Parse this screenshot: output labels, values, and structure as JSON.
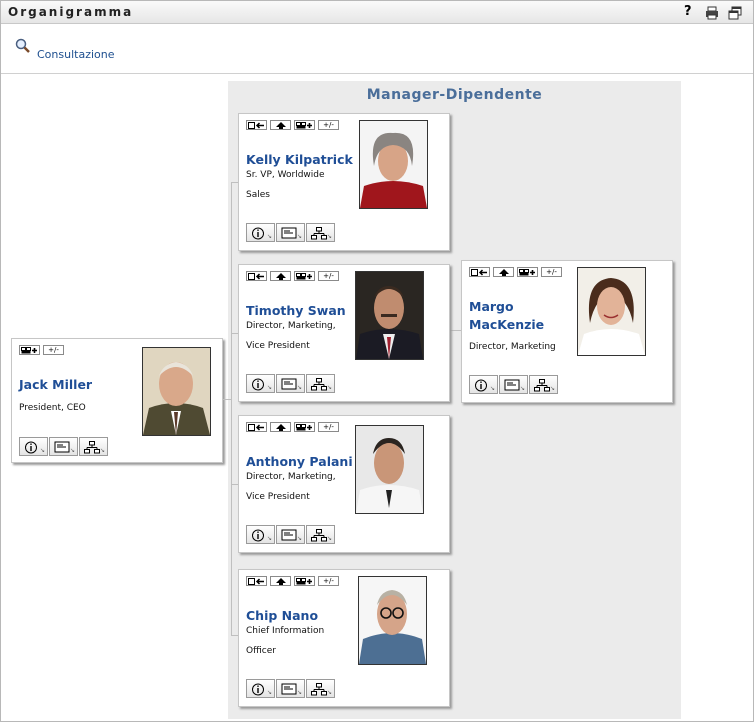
{
  "window": {
    "title": "Organigramma",
    "help_label": "?"
  },
  "toolbar": {
    "lookup_label": "Consultazione"
  },
  "panel": {
    "title": "Manager-Dipendente"
  },
  "colors": {
    "link": "#1f4e96",
    "panel_bg": "#ebebeb",
    "panel_title": "#4a6e9a"
  },
  "root": {
    "name": "Jack Miller",
    "title_line1": "President, CEO",
    "title_line2": ""
  },
  "reports": [
    {
      "name": "Kelly Kilpatrick",
      "title_line1": "Sr. VP, Worldwide",
      "title_line2": "Sales"
    },
    {
      "name": "Timothy Swan",
      "title_line1": "Director, Marketing,",
      "title_line2": "Vice President"
    },
    {
      "name": "Anthony Palani",
      "title_line1": "Director, Marketing,",
      "title_line2": "Vice President"
    },
    {
      "name": "Chip Nano",
      "title_line1": "Chief Information",
      "title_line2": "Officer"
    }
  ],
  "subreport": {
    "name_line1": "Margo",
    "name_line2": "MacKenzie",
    "title_line1": "Director, Marketing"
  },
  "card_buttons": {
    "plusminus": "+/-"
  },
  "icons": [
    "help-icon",
    "print-icon",
    "restore-window-icon",
    "magnifier-icon",
    "set-root-icon",
    "up-manager-icon",
    "show-reports-icon",
    "expand-collapse-icon",
    "info-icon",
    "vcard-icon",
    "org-chart-icon"
  ]
}
